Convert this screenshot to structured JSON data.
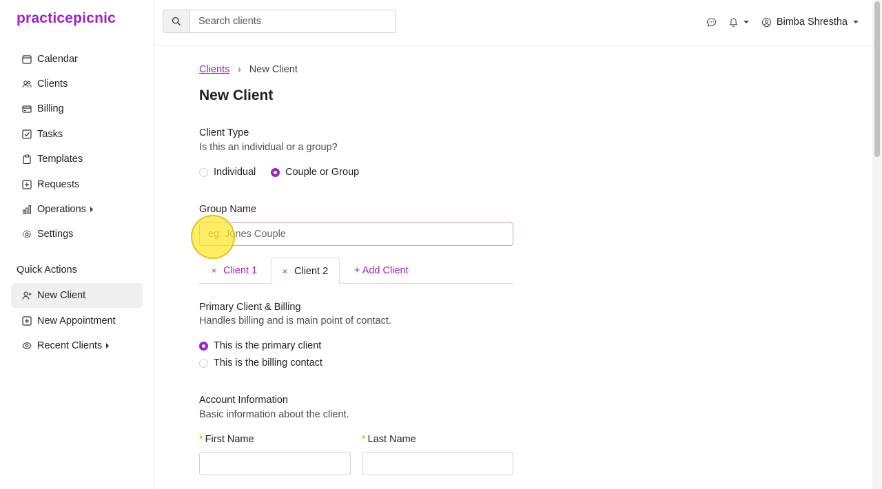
{
  "app": {
    "logo": "practicepicnic",
    "accent_color": "#a020c0"
  },
  "sidebar": {
    "items": [
      {
        "label": "Calendar",
        "icon": "calendar-icon"
      },
      {
        "label": "Clients",
        "icon": "users-icon"
      },
      {
        "label": "Billing",
        "icon": "credit-card-icon"
      },
      {
        "label": "Tasks",
        "icon": "checkbox-icon"
      },
      {
        "label": "Templates",
        "icon": "clipboard-icon"
      },
      {
        "label": "Requests",
        "icon": "plus-square-icon"
      },
      {
        "label": "Operations",
        "icon": "bar-chart-icon"
      },
      {
        "label": "Settings",
        "icon": "gear-icon"
      }
    ],
    "quick_actions_label": "Quick Actions",
    "quick_actions": [
      {
        "label": "New Client",
        "icon": "user-plus-icon",
        "active": true
      },
      {
        "label": "New Appointment",
        "icon": "plus-square-icon"
      },
      {
        "label": "Recent Clients",
        "icon": "eye-icon"
      }
    ]
  },
  "header": {
    "search_placeholder": "Search clients",
    "user_name": "Bimba Shrestha"
  },
  "breadcrumb": {
    "parent": "Clients",
    "separator": "›",
    "current": "New Client"
  },
  "page_title": "New Client",
  "client_type": {
    "label": "Client Type",
    "description": "Is this an individual or a group?",
    "options": [
      "Individual",
      "Couple or Group"
    ],
    "selected": "Couple or Group"
  },
  "group_name": {
    "label": "Group Name",
    "placeholder": "eg: Jones Couple",
    "value": ""
  },
  "tabs": [
    {
      "label": "Client 1",
      "closable": true,
      "active": false
    },
    {
      "label": "Client 2",
      "closable": true,
      "active": true
    },
    {
      "label": "+ Add Client",
      "closable": false,
      "active": false
    }
  ],
  "tab_close_glyph": "×",
  "primary_billing": {
    "label": "Primary Client & Billing",
    "description": "Handles billing and is main point of contact.",
    "options": [
      "This is the primary client",
      "This is the billing contact"
    ],
    "selected": "This is the primary client"
  },
  "account_info": {
    "label": "Account Information",
    "description": "Basic information about the client.",
    "first_name_label": "First Name",
    "last_name_label": "Last Name",
    "required_marker": "*"
  }
}
